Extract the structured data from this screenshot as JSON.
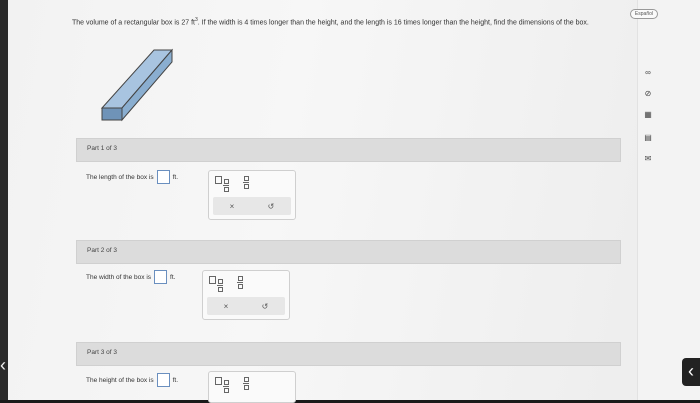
{
  "problem": {
    "text_pre": "The volume of a rectangular box is 27 ft",
    "exponent": "3",
    "text_post": ". If the width is 4 times longer than the height, and the length is 16 times longer than the height, find the dimensions of the box."
  },
  "language_button": "Español",
  "parts": [
    {
      "header": "Part 1 of 3",
      "prompt": "The length of the box is",
      "unit": "ft."
    },
    {
      "header": "Part 2 of 3",
      "prompt": "The width of the box is",
      "unit": "ft."
    },
    {
      "header": "Part 3 of 3",
      "prompt": "The height of the box is",
      "unit": "ft."
    }
  ],
  "toolbar": {
    "clear_symbol": "×",
    "undo_symbol": "↺"
  },
  "sidebar_icons": [
    "infinity-icon",
    "check-circle-icon",
    "calculator-icon",
    "grid-icon",
    "mail-icon"
  ],
  "nav": {
    "left": "‹",
    "right": "‹"
  }
}
